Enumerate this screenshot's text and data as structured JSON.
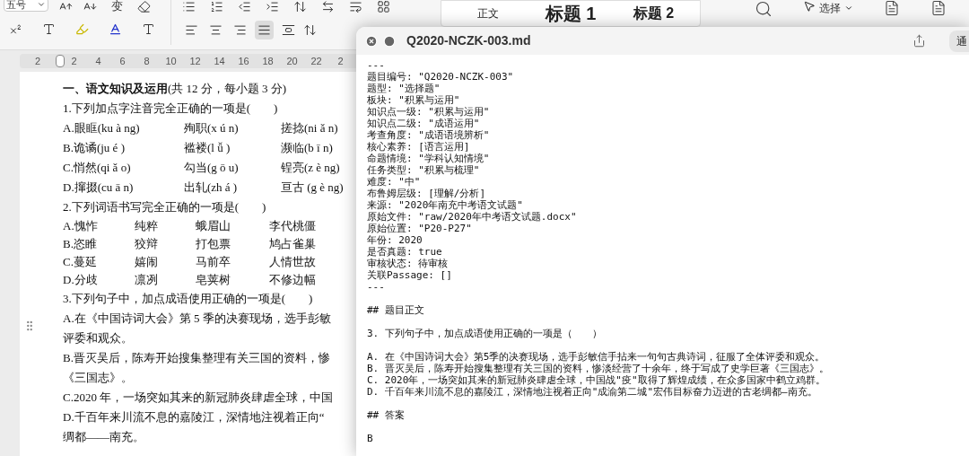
{
  "toolbar": {
    "font_size": "五号",
    "phonetic_button": "变",
    "align_buttons": [
      {
        "selected": false
      },
      {
        "selected": false
      },
      {
        "selected": false
      },
      {
        "selected": true
      },
      {
        "selected": false
      }
    ],
    "styles": [
      {
        "label": "正文",
        "kind": "body"
      },
      {
        "label": "标题 1",
        "kind": "h1"
      },
      {
        "label": "标题 2",
        "kind": "h2"
      }
    ],
    "select_button": "选择"
  },
  "ruler": {
    "ticks": [
      "2",
      "2",
      "4",
      "6",
      "8",
      "10",
      "12",
      "14",
      "16",
      "18",
      "20",
      "22",
      "2"
    ]
  },
  "document": {
    "lines": [
      {
        "kind": "text",
        "text": "**一、语文知识及运用**(共 12 分，每小题 3 分)"
      },
      {
        "kind": "text",
        "text": "1.下列加点字注音完全正确的一项是(　　)"
      },
      {
        "kind": "options3",
        "cells": [
          "A.眼眶(ku à ng)",
          "殉职(x ú n)",
          "搓捻(ni ǎ n)"
        ]
      },
      {
        "kind": "options3",
        "cells": [
          "B.诡谲(ju é )",
          "褴褛(l ǚ )",
          "濒临(b ī n)"
        ]
      },
      {
        "kind": "options3",
        "cells": [
          "C.悄然(qi ǎ o)",
          "勾当(g ō u)",
          "锃亮(z è ng)"
        ]
      },
      {
        "kind": "options3",
        "cells": [
          "D.撺掇(cu ā n)",
          "出轧(zh á )",
          "亘古 (g è ng)"
        ]
      },
      {
        "kind": "text",
        "text": "2.下列词语书写完全正确的一项是(　　)"
      },
      {
        "kind": "options4",
        "cells": [
          "A.愧怍",
          "纯粹",
          "蛾眉山",
          "李代桃僵"
        ]
      },
      {
        "kind": "options4",
        "cells": [
          "B.恣睢",
          "狡辩",
          "打包票",
          "鸠占雀巢"
        ]
      },
      {
        "kind": "options4",
        "cells": [
          "C.蔓延",
          "嬉闹",
          "马前卒",
          "人情世故"
        ]
      },
      {
        "kind": "options4",
        "cells": [
          "D.分歧",
          "凛冽",
          "皂荚树",
          "不修边幅"
        ]
      },
      {
        "kind": "text",
        "text": "3.下列句子中，加点成语使用正确的一项是(　　)"
      },
      {
        "kind": "text",
        "text": "A.在《中国诗词大会》第 5 季的决赛现场，选手彭敏"
      },
      {
        "kind": "text",
        "text": "评委和观众。"
      },
      {
        "kind": "text",
        "text": "B.晋灭吴后，陈寿开始搜集整理有关三国的资料，惨"
      },
      {
        "kind": "text",
        "text": "《三国志》。"
      },
      {
        "kind": "text",
        "text": "C.2020 年，一场突如其来的新冠肺炎肆虐全球，中国"
      },
      {
        "kind": "text",
        "text": "D.千百年来川流不息的嘉陵江，深情地注视着正向“"
      },
      {
        "kind": "text",
        "text": "绸都——南充。"
      }
    ]
  },
  "preview": {
    "title": "Q2020-NCZK-003.md",
    "action_button": "通",
    "blocks": [
      [
        "---",
        "题目编号: \"Q2020-NCZK-003\"",
        "题型: \"选择题\"",
        "板块: \"积累与运用\"",
        "知识点一级: \"积累与运用\"",
        "知识点二级: \"成语运用\"",
        "考查角度: \"成语语境辨析\"",
        "核心素养: [语言运用]",
        "命题情境: \"学科认知情境\"",
        "任务类型: \"积累与梳理\"",
        "难度: \"中\"",
        "布鲁姆层级: [理解/分析]",
        "来源: \"2020年南充中考语文试题\"",
        "原始文件: \"raw/2020年中考语文试题.docx\"",
        "原始位置: \"P20-P27\"",
        "年份: 2020",
        "是否真题: true",
        "审核状态: 待审核",
        "关联Passage: []",
        "---"
      ],
      [
        "## 题目正文"
      ],
      [
        "3. 下列句子中，加点成语使用正确的一项是（　　）"
      ],
      [
        "A. 在《中国诗词大会》第5季的决赛现场，选手彭敏信手拈来一句句古典诗词，征服了全体评委和观众。",
        "B. 晋灭吴后，陈寿开始搜集整理有关三国的资料，惨淡经营了十余年，终于写成了史学巨著《三国志》。",
        "C. 2020年，一场突如其来的新冠肺炎肆虐全球，中国战\"疫\"取得了辉煌成绩，在众多国家中鹤立鸡群。",
        "D. 千百年来川流不息的嘉陵江，深情地注视着正向\"成渝第二城\"宏伟目标奋力迈进的古老绸都—南充。"
      ],
      [
        "## 答案"
      ],
      [
        "B"
      ]
    ]
  }
}
